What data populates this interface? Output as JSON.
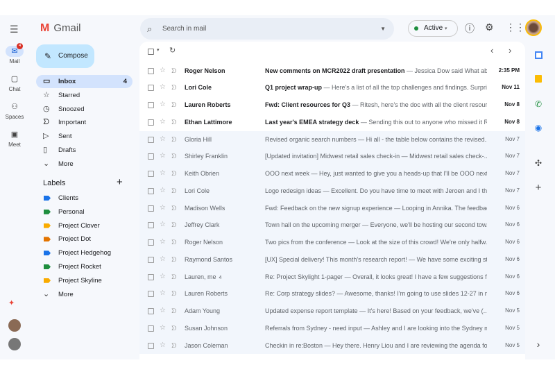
{
  "app": {
    "name": "Gmail"
  },
  "rail": [
    {
      "label": "Mail",
      "icon": "mail-icon",
      "badge": "4"
    },
    {
      "label": "Chat",
      "icon": "chat-icon"
    },
    {
      "label": "Spaces",
      "icon": "spaces-icon"
    },
    {
      "label": "Meet",
      "icon": "meet-icon"
    }
  ],
  "search": {
    "placeholder": "Search in mail"
  },
  "status": {
    "label": "Active",
    "color": "#1e8e3e"
  },
  "compose": {
    "label": "Compose"
  },
  "nav": [
    {
      "label": "Inbox",
      "count": "4",
      "icon": "inbox-icon",
      "glyph": "▭",
      "selected": true
    },
    {
      "label": "Starred",
      "icon": "star-icon",
      "glyph": "☆"
    },
    {
      "label": "Snoozed",
      "icon": "clock-icon",
      "glyph": "◷"
    },
    {
      "label": "Important",
      "icon": "important-icon",
      "glyph": "ᗤ"
    },
    {
      "label": "Sent",
      "icon": "send-icon",
      "glyph": "▷"
    },
    {
      "label": "Drafts",
      "icon": "draft-icon",
      "glyph": "▯"
    },
    {
      "label": "More",
      "icon": "chevron-down-icon",
      "glyph": "⌄"
    }
  ],
  "labels": {
    "title": "Labels",
    "items": [
      {
        "label": "Clients",
        "color": "#1a73e8"
      },
      {
        "label": "Personal",
        "color": "#1e8e3e"
      },
      {
        "label": "Project Clover",
        "color": "#f9ab00"
      },
      {
        "label": "Project Dot",
        "color": "#e37400"
      },
      {
        "label": "Project Hedgehog",
        "color": "#1a73e8"
      },
      {
        "label": "Project Rocket",
        "color": "#1e8e3e"
      },
      {
        "label": "Project Skyline",
        "color": "#f9ab00"
      }
    ],
    "more": "More"
  },
  "emails": [
    {
      "sender": "Roger Nelson",
      "subject": "New comments on MCR2022 draft presentation",
      "preview": " — Jessica Dow said What ab...",
      "date": "2:35 PM",
      "unread": true
    },
    {
      "sender": "Lori Cole",
      "subject": "Q1 project wrap-up",
      "preview": " — Here's a list of all the top challenges and findings. Surpri...",
      "date": "Nov 11",
      "unread": true
    },
    {
      "sender": "Lauren Roberts",
      "subject": "Fwd: Client resources for Q3",
      "preview": " — Ritesh, here's the doc with all the client resour...",
      "date": "Nov 8",
      "unread": true
    },
    {
      "sender": "Ethan Lattimore",
      "subject": "Last year's EMEA strategy deck",
      "preview": " — Sending this out to anyone who missed it R...",
      "date": "Nov 8",
      "unread": true
    },
    {
      "sender": "Gloria Hill",
      "subject": "Revised organic search numbers",
      "preview": " — Hi all - the table below contains the revised...",
      "date": "Nov 7"
    },
    {
      "sender": "Shirley Franklin",
      "subject": "[Updated invitation] Midwest retail sales check-in",
      "preview": " — Midwest retail sales check-...",
      "date": "Nov 7"
    },
    {
      "sender": "Keith Obrien",
      "subject": "OOO next week",
      "preview": " — Hey, just wanted to give you a heads-up that I'll be OOO next...",
      "date": "Nov 7"
    },
    {
      "sender": "Lori Cole",
      "subject": "Logo redesign ideas",
      "preview": " — Excellent. Do you have time to meet with Jeroen and I thi...",
      "date": "Nov 7"
    },
    {
      "sender": "Madison Wells",
      "subject": "Fwd: Feedback on the new signup experience",
      "preview": " — Looping in Annika. The feedbac...",
      "date": "Nov 6"
    },
    {
      "sender": "Jeffrey Clark",
      "subject": "Town hall on the upcoming merger",
      "preview": " — Everyone, we'll be hosting our second tow...",
      "date": "Nov 6"
    },
    {
      "sender": "Roger Nelson",
      "subject": "Two pics from the conference",
      "preview": " — Look at the size of this crowd! We're only halfw...",
      "date": "Nov 6"
    },
    {
      "sender": "Raymond Santos",
      "subject": "[UX] Special delivery! This month's research report!",
      "preview": " — We have some exciting st...",
      "date": "Nov 6"
    },
    {
      "sender": "Lauren, me",
      "count": "4",
      "subject": "Re: Project Skylight 1-pager",
      "preview": " — Overall, it looks great! I have a few suggestions fo...",
      "date": "Nov 6"
    },
    {
      "sender": "Lauren Roberts",
      "subject": "Re: Corp strategy slides?",
      "preview": " — Awesome, thanks! I'm going to use slides 12-27 in m...",
      "date": "Nov 6"
    },
    {
      "sender": "Adam Young",
      "subject": "Updated expense report template",
      "preview": " — It's here! Based on your feedback, we've (...",
      "date": "Nov 5"
    },
    {
      "sender": "Susan Johnson",
      "subject": "Referrals from Sydney - need input",
      "preview": " — Ashley and I are looking into the Sydney m...",
      "date": "Nov 5"
    },
    {
      "sender": "Jason Coleman",
      "subject": "Checkin in re:Boston",
      "preview": " — Hey there. Henry Liou and I are reviewing the agenda for...",
      "date": "Nov 5"
    }
  ]
}
